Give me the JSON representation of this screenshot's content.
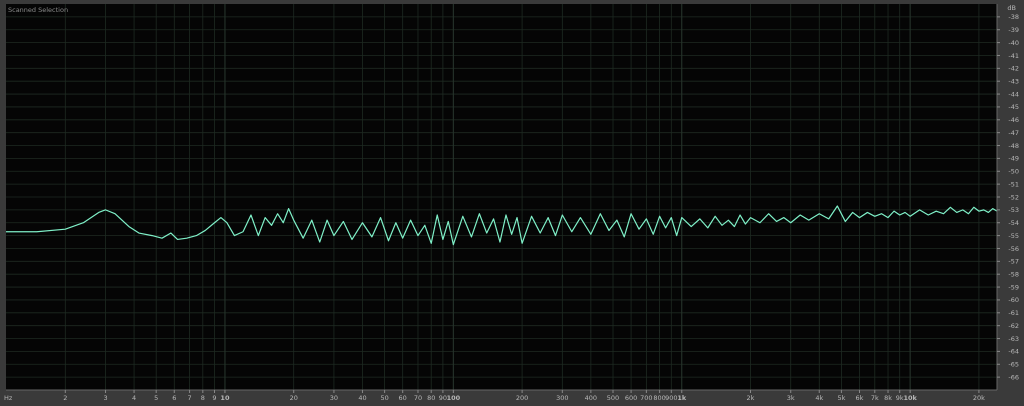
{
  "panel": {
    "title": "Scanned Selection"
  },
  "colors": {
    "background": "#050505",
    "frame": "#3a3a3a",
    "grid": "#1e2a22",
    "grid_major": "#26332b",
    "trace": "#7ff0c8",
    "tick_label": "#b8b8b8"
  },
  "chart_data": {
    "type": "line",
    "x_scale": "log",
    "xlim": [
      1.1,
      24000
    ],
    "ylim": [
      -67,
      -37
    ],
    "x_unit_label": "Hz",
    "y_unit_label": "dB",
    "grid": true,
    "x_ticks": [
      {
        "value": 2,
        "label": "2"
      },
      {
        "value": 3,
        "label": "3"
      },
      {
        "value": 4,
        "label": "4"
      },
      {
        "value": 5,
        "label": "5"
      },
      {
        "value": 6,
        "label": "6"
      },
      {
        "value": 7,
        "label": "7"
      },
      {
        "value": 8,
        "label": "8"
      },
      {
        "value": 9,
        "label": "9"
      },
      {
        "value": 10,
        "label": "10",
        "major": true
      },
      {
        "value": 20,
        "label": "20"
      },
      {
        "value": 30,
        "label": "30"
      },
      {
        "value": 40,
        "label": "40"
      },
      {
        "value": 50,
        "label": "50"
      },
      {
        "value": 60,
        "label": "60"
      },
      {
        "value": 70,
        "label": "70"
      },
      {
        "value": 80,
        "label": "80"
      },
      {
        "value": 90,
        "label": "90"
      },
      {
        "value": 100,
        "label": "100",
        "major": true
      },
      {
        "value": 200,
        "label": "200"
      },
      {
        "value": 300,
        "label": "300"
      },
      {
        "value": 400,
        "label": "400"
      },
      {
        "value": 500,
        "label": "500"
      },
      {
        "value": 600,
        "label": "600"
      },
      {
        "value": 700,
        "label": "700"
      },
      {
        "value": 800,
        "label": "800"
      },
      {
        "value": 900,
        "label": "900"
      },
      {
        "value": 1000,
        "label": "1k",
        "major": true
      },
      {
        "value": 2000,
        "label": "2k"
      },
      {
        "value": 3000,
        "label": "3k"
      },
      {
        "value": 4000,
        "label": "4k"
      },
      {
        "value": 5000,
        "label": "5k"
      },
      {
        "value": 6000,
        "label": "6k"
      },
      {
        "value": 7000,
        "label": "7k"
      },
      {
        "value": 8000,
        "label": "8k"
      },
      {
        "value": 9000,
        "label": "9k"
      },
      {
        "value": 10000,
        "label": "10k",
        "major": true
      },
      {
        "value": 20000,
        "label": "20k"
      }
    ],
    "y_ticks": [
      -38,
      -39,
      -40,
      -41,
      -42,
      -43,
      -44,
      -45,
      -46,
      -47,
      -48,
      -49,
      -50,
      -51,
      -52,
      -53,
      -54,
      -55,
      -56,
      -57,
      -58,
      -59,
      -60,
      -61,
      -62,
      -63,
      -64,
      -65,
      -66
    ],
    "series": [
      {
        "x": [
          1.1,
          1.5,
          2,
          2.4,
          2.8,
          3,
          3.3,
          3.8,
          4.2,
          4.8,
          5.3,
          5.8,
          6.2,
          6.8,
          7.5,
          8.2,
          9,
          9.6,
          10.2,
          11,
          12,
          13,
          14,
          15,
          16,
          17,
          18,
          19,
          20,
          22,
          24,
          26,
          28,
          30,
          33,
          36,
          40,
          44,
          48,
          52,
          56,
          60,
          65,
          70,
          75,
          80,
          85,
          90,
          95,
          100,
          110,
          120,
          130,
          140,
          150,
          160,
          170,
          180,
          190,
          200,
          220,
          240,
          260,
          280,
          300,
          330,
          360,
          400,
          440,
          480,
          520,
          560,
          600,
          650,
          700,
          750,
          800,
          850,
          900,
          950,
          1000,
          1100,
          1200,
          1300,
          1400,
          1500,
          1600,
          1700,
          1800,
          1900,
          2000,
          2200,
          2400,
          2600,
          2800,
          3000,
          3300,
          3600,
          4000,
          4400,
          4800,
          5200,
          5600,
          6000,
          6500,
          7000,
          7500,
          8000,
          8500,
          9000,
          9500,
          10000,
          11000,
          12000,
          13000,
          14000,
          15000,
          16000,
          17000,
          18000,
          19000,
          20000,
          21000,
          22000,
          23000,
          24000
        ],
        "y": [
          -54.7,
          -54.7,
          -54.5,
          -54.0,
          -53.2,
          -53.0,
          -53.3,
          -54.3,
          -54.8,
          -55.0,
          -55.2,
          -54.8,
          -55.3,
          -55.2,
          -55.0,
          -54.6,
          -54.0,
          -53.6,
          -54.0,
          -55.0,
          -54.7,
          -53.4,
          -55.0,
          -53.6,
          -54.2,
          -53.3,
          -54.0,
          -52.9,
          -53.8,
          -55.2,
          -53.8,
          -55.5,
          -53.8,
          -55.0,
          -53.9,
          -55.3,
          -54.0,
          -55.1,
          -53.6,
          -55.4,
          -54.0,
          -55.2,
          -53.8,
          -55.0,
          -54.2,
          -55.6,
          -53.4,
          -55.3,
          -53.9,
          -55.7,
          -53.5,
          -55.1,
          -53.3,
          -54.8,
          -53.7,
          -55.5,
          -53.4,
          -54.9,
          -53.6,
          -55.6,
          -53.5,
          -54.8,
          -53.6,
          -55.0,
          -53.4,
          -54.7,
          -53.6,
          -54.9,
          -53.3,
          -54.6,
          -53.8,
          -55.1,
          -53.3,
          -54.5,
          -53.7,
          -54.9,
          -53.5,
          -54.4,
          -53.6,
          -55.0,
          -53.6,
          -54.3,
          -53.7,
          -54.4,
          -53.5,
          -54.2,
          -53.8,
          -54.3,
          -53.4,
          -54.1,
          -53.6,
          -54.0,
          -53.3,
          -53.9,
          -53.6,
          -54.0,
          -53.4,
          -53.8,
          -53.3,
          -53.7,
          -52.7,
          -53.9,
          -53.2,
          -53.6,
          -53.2,
          -53.5,
          -53.3,
          -53.6,
          -53.1,
          -53.4,
          -53.2,
          -53.5,
          -53.0,
          -53.4,
          -53.1,
          -53.3,
          -52.8,
          -53.2,
          -53.0,
          -53.3,
          -52.8,
          -53.1,
          -53.0,
          -53.2,
          -52.9,
          -53.1
        ]
      }
    ]
  }
}
